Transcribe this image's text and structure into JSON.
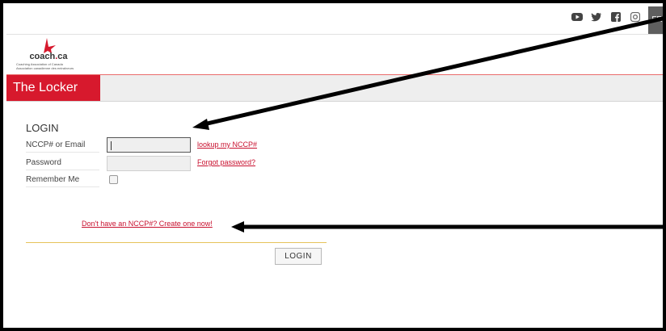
{
  "header": {
    "social_icons": [
      "youtube-icon",
      "twitter-icon",
      "facebook-icon",
      "instagram-icon"
    ],
    "language_toggle": "FR"
  },
  "logo": {
    "word_main": "coach",
    "word_dot": ".",
    "word_ext": "ca",
    "sub_en": "Coaching Association of Canada",
    "sub_fr": "Association canadienne des entraîneurs"
  },
  "nav": {
    "locker_title": "The Locker"
  },
  "login": {
    "title": "LOGIN",
    "fields": {
      "nccp_label": "NCCP# or Email",
      "nccp_value": "",
      "password_label": "Password",
      "password_value": "",
      "remember_label": "Remember Me",
      "remember_checked": false
    },
    "links": {
      "lookup": "lookup my NCCP#",
      "forgot": "Forgot password?",
      "create": "Don't have an NCCP#? Create one now!"
    },
    "submit_label": "LOGIN"
  },
  "colors": {
    "brand_red": "#d7192d",
    "link_red": "#c8102e",
    "divider_gold": "#e6c25a",
    "annotation_arrow": "#000000"
  }
}
